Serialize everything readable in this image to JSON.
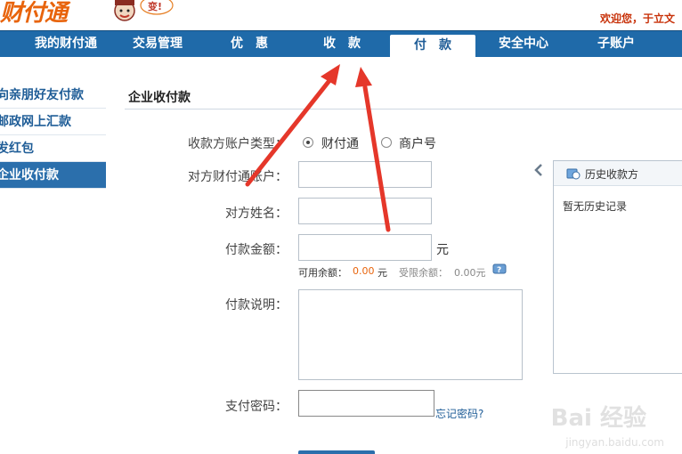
{
  "header": {
    "logo": "财付通",
    "mascot_bubble": "变!",
    "welcome": "欢迎您，于立文"
  },
  "nav": {
    "items": [
      "我的财付通",
      "交易管理",
      "优　惠",
      "收　款",
      "付　款",
      "安全中心",
      "子账户"
    ],
    "active": "付　款"
  },
  "sidebar": {
    "items": [
      "向亲朋好友付款",
      "邮政网上汇款",
      "发红包",
      "企业收付款"
    ],
    "active": "企业收付款"
  },
  "form": {
    "title": "企业收付款",
    "account_type_label": "收款方账户类型：",
    "option_tenpay": "财付通",
    "option_merchant": "商户号",
    "account_label": "对方财付通账户：",
    "name_label": "对方姓名：",
    "amount_label": "付款金额：",
    "amount_unit": "元",
    "available_label": "可用余额：",
    "available_value": "0.00",
    "available_unit": "元",
    "limited_label": "受限余额：",
    "limited_value": "0.00元",
    "desc_label": "付款说明：",
    "password_label": "支付密码：",
    "forgot": "忘记密码?"
  },
  "history": {
    "title": "历史收款方",
    "empty": "暂无历史记录"
  },
  "watermark": {
    "brand": "Bai 经验",
    "url": "jingyan.baidu.com"
  },
  "colors": {
    "nav_bg": "#1f6aa9",
    "accent_orange": "#e8640c",
    "arrow_red": "#e5372a"
  }
}
